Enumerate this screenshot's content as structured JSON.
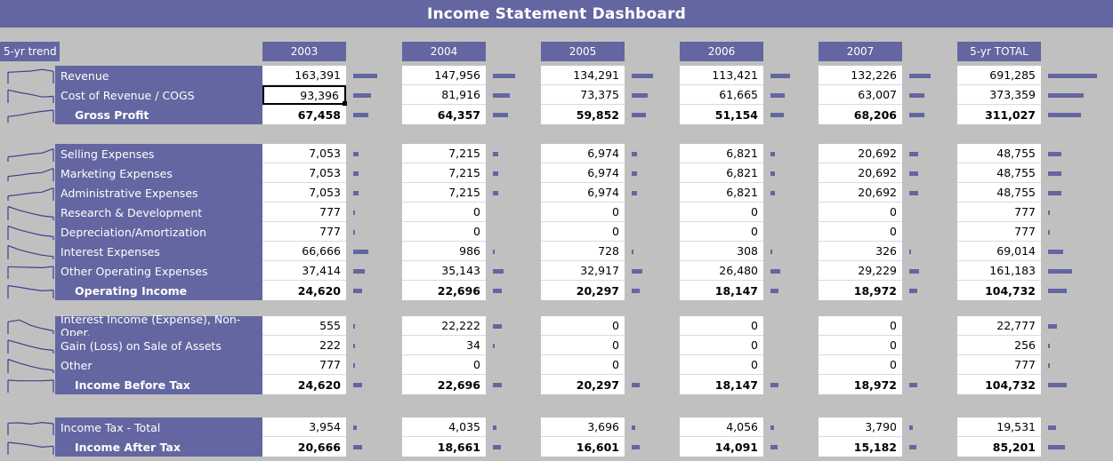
{
  "title": "Income Statement Dashboard",
  "trend_header": "5-yr trend",
  "columns": [
    "2003",
    "2004",
    "2005",
    "2006",
    "2007",
    "5-yr TOTAL"
  ],
  "colors": {
    "accent": "#6366a0",
    "background": "#c0c0c0",
    "cell_background": "#ffffff",
    "header_text": "#ffffff",
    "value_text": "#000000",
    "selected_border": "#000000",
    "gridline": "#d6daea"
  },
  "selected_cell": {
    "row": "Cost of Revenue / COGS",
    "column": "2003",
    "value": "93,396"
  },
  "groups": [
    {
      "name": "gross-profit-group",
      "rows": [
        {
          "label": "Revenue",
          "total": false,
          "values": [
            "163,391",
            "147,956",
            "134,291",
            "113,421",
            "132,226",
            "691,285"
          ],
          "magnitudes": [
            163391,
            147956,
            134291,
            113421,
            132226,
            691285
          ]
        },
        {
          "label": "Cost of Revenue / COGS",
          "total": false,
          "values": [
            "93,396",
            "81,916",
            "73,375",
            "61,665",
            "63,007",
            "373,359"
          ],
          "magnitudes": [
            93396,
            81916,
            73375,
            61665,
            63007,
            373359
          ]
        },
        {
          "label": "Gross Profit",
          "total": true,
          "values": [
            "67,458",
            "64,357",
            "59,852",
            "51,154",
            "68,206",
            "311,027"
          ],
          "magnitudes": [
            67458,
            64357,
            59852,
            51154,
            68206,
            311027
          ]
        }
      ]
    },
    {
      "name": "operating-income-group",
      "rows": [
        {
          "label": "Selling Expenses",
          "total": false,
          "values": [
            "7,053",
            "7,215",
            "6,974",
            "6,821",
            "20,692",
            "48,755"
          ],
          "magnitudes": [
            7053,
            7215,
            6974,
            6821,
            20692,
            48755
          ]
        },
        {
          "label": "Marketing Expenses",
          "total": false,
          "values": [
            "7,053",
            "7,215",
            "6,974",
            "6,821",
            "20,692",
            "48,755"
          ],
          "magnitudes": [
            7053,
            7215,
            6974,
            6821,
            20692,
            48755
          ]
        },
        {
          "label": "Administrative Expenses",
          "total": false,
          "values": [
            "7,053",
            "7,215",
            "6,974",
            "6,821",
            "20,692",
            "48,755"
          ],
          "magnitudes": [
            7053,
            7215,
            6974,
            6821,
            20692,
            48755
          ]
        },
        {
          "label": "Research & Development",
          "total": false,
          "values": [
            "777",
            "0",
            "0",
            "0",
            "0",
            "777"
          ],
          "magnitudes": [
            777,
            0,
            0,
            0,
            0,
            777
          ]
        },
        {
          "label": "Depreciation/Amortization",
          "total": false,
          "values": [
            "777",
            "0",
            "0",
            "0",
            "0",
            "777"
          ],
          "magnitudes": [
            777,
            0,
            0,
            0,
            0,
            777
          ]
        },
        {
          "label": "Interest Expenses",
          "total": false,
          "values": [
            "66,666",
            "986",
            "728",
            "308",
            "326",
            "69,014"
          ],
          "magnitudes": [
            66666,
            986,
            728,
            308,
            326,
            69014
          ]
        },
        {
          "label": "Other Operating Expenses",
          "total": false,
          "values": [
            "37,414",
            "35,143",
            "32,917",
            "26,480",
            "29,229",
            "161,183"
          ],
          "magnitudes": [
            37414,
            35143,
            32917,
            26480,
            29229,
            161183
          ]
        },
        {
          "label": "Operating Income",
          "total": true,
          "values": [
            "24,620",
            "22,696",
            "20,297",
            "18,147",
            "18,972",
            "104,732"
          ],
          "magnitudes": [
            24620,
            22696,
            20297,
            18147,
            18972,
            104732
          ]
        }
      ]
    },
    {
      "name": "income-before-tax-group",
      "rows": [
        {
          "label": "Interest Income (Expense), Non-Oper.",
          "total": false,
          "values": [
            "555",
            "22,222",
            "0",
            "0",
            "0",
            "22,777"
          ],
          "magnitudes": [
            555,
            22222,
            0,
            0,
            0,
            22777
          ]
        },
        {
          "label": "Gain (Loss) on Sale of Assets",
          "total": false,
          "values": [
            "222",
            "34",
            "0",
            "0",
            "0",
            "256"
          ],
          "magnitudes": [
            222,
            34,
            0,
            0,
            0,
            256
          ]
        },
        {
          "label": "Other",
          "total": false,
          "values": [
            "777",
            "0",
            "0",
            "0",
            "0",
            "777"
          ],
          "magnitudes": [
            777,
            0,
            0,
            0,
            0,
            777
          ]
        },
        {
          "label": "Income Before Tax",
          "total": true,
          "values": [
            "24,620",
            "22,696",
            "20,297",
            "18,147",
            "18,972",
            "104,732"
          ],
          "magnitudes": [
            24620,
            22696,
            20297,
            18147,
            18972,
            104732
          ]
        }
      ]
    },
    {
      "name": "income-after-tax-group",
      "rows": [
        {
          "label": "Income Tax - Total",
          "total": false,
          "values": [
            "3,954",
            "4,035",
            "3,696",
            "4,056",
            "3,790",
            "19,531"
          ],
          "magnitudes": [
            3954,
            4035,
            3696,
            4056,
            3790,
            19531
          ]
        },
        {
          "label": "Income After Tax",
          "total": true,
          "values": [
            "20,666",
            "18,661",
            "16,601",
            "14,091",
            "15,182",
            "85,201"
          ],
          "magnitudes": [
            20666,
            18661,
            16601,
            14091,
            15182,
            85201
          ]
        }
      ]
    }
  ],
  "sparklines": [
    {
      "row": "Revenue",
      "points": [
        0.3,
        0.26,
        0.22,
        0.12,
        0.24
      ]
    },
    {
      "row": "Cost of Revenue / COGS",
      "points": [
        0.18,
        0.34,
        0.46,
        0.62,
        0.58
      ]
    },
    {
      "row": "Gross Profit",
      "points": [
        0.62,
        0.54,
        0.4,
        0.3,
        0.22
      ]
    },
    {
      "row": "Selling Expenses",
      "points": [
        0.7,
        0.62,
        0.52,
        0.46,
        0.2
      ]
    },
    {
      "row": "Marketing Expenses",
      "points": [
        0.7,
        0.62,
        0.52,
        0.46,
        0.2
      ]
    },
    {
      "row": "Administrative Expenses",
      "points": [
        0.7,
        0.62,
        0.52,
        0.46,
        0.2
      ]
    },
    {
      "row": "Research & Development",
      "points": [
        0.14,
        0.38,
        0.56,
        0.72,
        0.8
      ]
    },
    {
      "row": "Depreciation/Amortization",
      "points": [
        0.14,
        0.38,
        0.56,
        0.72,
        0.8
      ]
    },
    {
      "row": "Interest Expenses",
      "points": [
        0.14,
        0.4,
        0.58,
        0.74,
        0.82
      ]
    },
    {
      "row": "Other Operating Expenses",
      "points": [
        0.24,
        0.26,
        0.28,
        0.3,
        0.22
      ]
    },
    {
      "row": "Operating Income",
      "points": [
        0.2,
        0.3,
        0.42,
        0.52,
        0.48
      ]
    },
    {
      "row": "Interest Income (Expense), Non-Oper.",
      "points": [
        0.24,
        0.12,
        0.46,
        0.66,
        0.8
      ]
    },
    {
      "row": "Gain (Loss) on Sale of Assets",
      "points": [
        0.16,
        0.36,
        0.56,
        0.72,
        0.8
      ]
    },
    {
      "row": "Other",
      "points": [
        0.14,
        0.38,
        0.58,
        0.74,
        0.82
      ]
    },
    {
      "row": "Income Before Tax",
      "points": [
        0.22,
        0.26,
        0.26,
        0.26,
        0.22
      ]
    },
    {
      "row": "Income Tax - Total",
      "points": [
        0.24,
        0.22,
        0.3,
        0.2,
        0.28
      ]
    },
    {
      "row": "Income After Tax",
      "points": [
        0.22,
        0.3,
        0.4,
        0.52,
        0.46
      ]
    }
  ]
}
